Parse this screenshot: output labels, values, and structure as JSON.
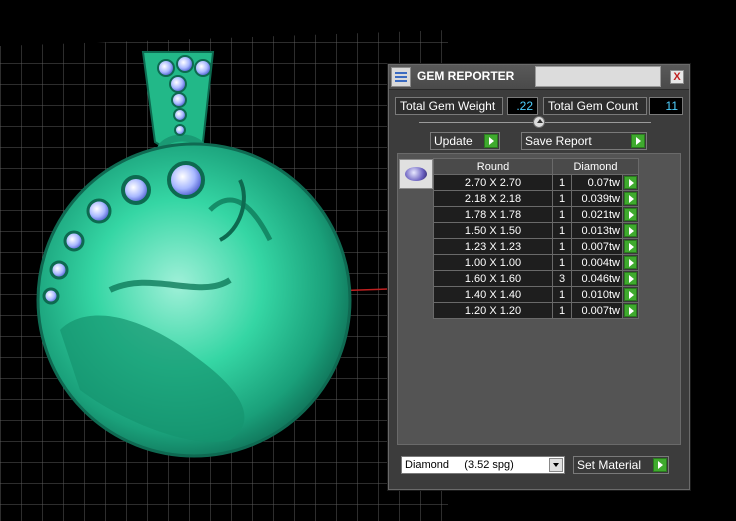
{
  "window": {
    "title": "GEM REPORTER",
    "close_glyph": "X"
  },
  "summary": {
    "total_weight_label": "Total Gem Weight",
    "total_weight_value": ".22",
    "total_count_label": "Total Gem Count",
    "total_count_value": "11"
  },
  "actions": {
    "update_label": "Update",
    "save_report_label": "Save Report"
  },
  "table": {
    "headers": [
      "Round",
      "Diamond"
    ],
    "rows": [
      {
        "size": "2.70 X 2.70",
        "count": "1",
        "weight": "0.07tw"
      },
      {
        "size": "2.18 X 2.18",
        "count": "1",
        "weight": "0.039tw"
      },
      {
        "size": "1.78 X 1.78",
        "count": "1",
        "weight": "0.021tw"
      },
      {
        "size": "1.50 X 1.50",
        "count": "1",
        "weight": "0.013tw"
      },
      {
        "size": "1.23 X 1.23",
        "count": "1",
        "weight": "0.007tw"
      },
      {
        "size": "1.00 X 1.00",
        "count": "1",
        "weight": "0.004tw"
      },
      {
        "size": "1.60 X 1.60",
        "count": "3",
        "weight": "0.046tw"
      },
      {
        "size": "1.40 X 1.40",
        "count": "1",
        "weight": "0.010tw"
      },
      {
        "size": "1.20 X 1.20",
        "count": "1",
        "weight": "0.007tw"
      }
    ]
  },
  "material": {
    "selected": "Diamond     (3.52 spg)",
    "set_label": "Set Material"
  },
  "colors": {
    "pendant": "#2fd6a0",
    "value_text": "#4fd0ff",
    "play_button": "#3faa2e"
  }
}
